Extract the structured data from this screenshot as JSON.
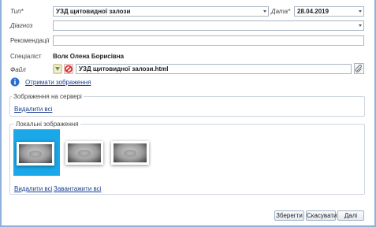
{
  "form": {
    "type_label": "Тип*",
    "type_value": "УЗД щитовидної залози",
    "date_label": "Дата*",
    "date_value": "28.04.2019",
    "diagnosis_label": "Діагноз",
    "diagnosis_value": "",
    "recommendations_label": "Рекомендації",
    "recommendations_value": "",
    "specialist_label": "Спеціаліст",
    "specialist_value": "Волк Олена Борисівна",
    "file_label": "Файл",
    "file_value": "УЗД щитовидної залози.html"
  },
  "get_images_link": "Отримати зображення",
  "server_group": {
    "title": "Зображення на сервері",
    "delete_all": "Видалити всі"
  },
  "local_group": {
    "title": "Локальні зображення",
    "delete_all": "Видалити всі",
    "download_all": "Завантажити всі",
    "thumbnails": [
      "thumbnail-1",
      "thumbnail-2",
      "thumbnail-3"
    ],
    "selected_index": 0
  },
  "buttons": {
    "save": "Зберегти",
    "cancel": "Скасувати",
    "next": "Далі"
  },
  "colors": {
    "selection": "#1aa8e8",
    "link": "#1b3f8f",
    "frame": "#8fb0d8"
  },
  "icons": [
    "dropdown-arrow-icon",
    "folder-icon",
    "no-entry-icon",
    "attach-icon",
    "info-icon"
  ]
}
